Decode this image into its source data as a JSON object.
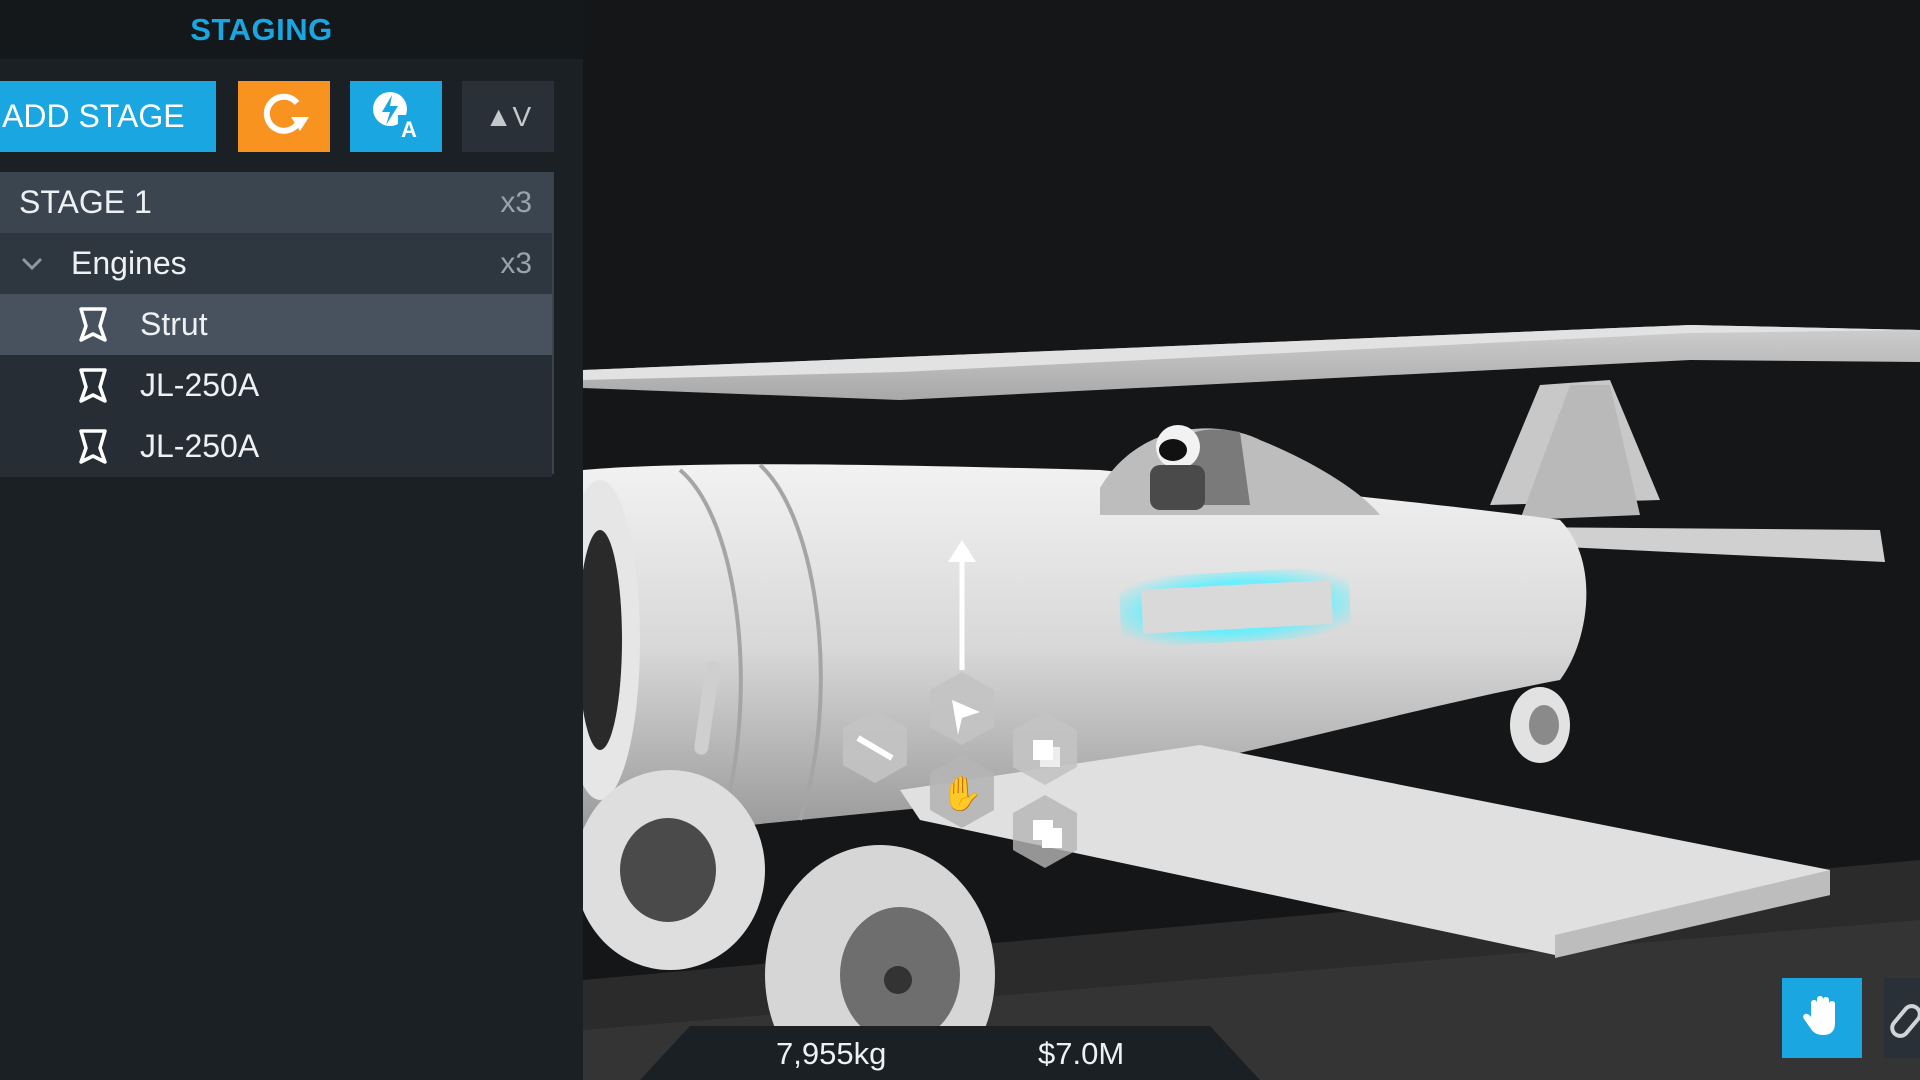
{
  "panel": {
    "title": "STAGING",
    "add_stage_label": "ADD STAGE",
    "reset_icon": "refresh-icon",
    "auto_stage_icon": "auto-stage-icon",
    "sort_label": "▲V"
  },
  "stages": [
    {
      "label": "STAGE 1",
      "count": "x3",
      "groups": [
        {
          "label": "Engines",
          "count": "x3",
          "parts": [
            {
              "label": "Strut",
              "selected": true
            },
            {
              "label": "JL-250A",
              "selected": false
            },
            {
              "label": "JL-250A",
              "selected": false
            }
          ]
        }
      ]
    }
  ],
  "stats": {
    "mass": "7,955kg",
    "cost": "$7.0M"
  },
  "colors": {
    "accent": "#1aa6e0",
    "orange": "#f7931e",
    "panel": "#1b2025"
  }
}
